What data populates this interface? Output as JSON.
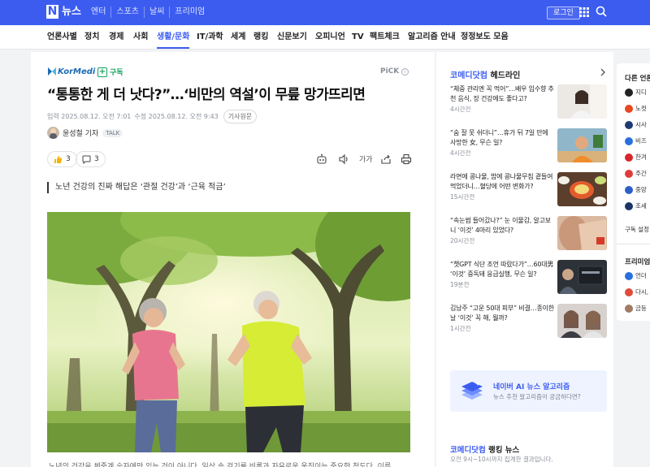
{
  "topbar": {
    "logo_mark": "N",
    "logo_text": "뉴스",
    "links": [
      "엔터",
      "스포츠",
      "날씨",
      "프리미엄"
    ],
    "login_label": "로그인"
  },
  "nav": {
    "items": [
      "언론사별",
      "정치",
      "경제",
      "사회",
      "생활/문화",
      "IT/과학",
      "세계",
      "랭킹",
      "신문보기",
      "오피니언",
      "TV",
      "팩트체크",
      "알고리즘 안내",
      "정정보도 모음"
    ],
    "active_index": 4
  },
  "article": {
    "press_name": "KorMedi",
    "subscribe_label": "구독",
    "pick_label": "PiCK",
    "headline": "“통통한 게 더 낫다?”…‘비만의 역설’이 무릎 망가뜨리면",
    "published": "입력 2025.08.12. 오전 7:01",
    "modified": "수정 2025.08.12. 오전 9:43",
    "original_label": "기사원문",
    "reporter": "윤성철 기자",
    "talk_label": "TALK",
    "reaction_count": "3",
    "comment_count": "3",
    "font_size_label": "가가",
    "subhead": "노년 건강의 진짜 해답은 ‘관절 건강’과 ‘근육 적금’",
    "body_preview": "노년의 건강을 체중계 숫자에만 있는 것이 아니다. 일상 속 걷기를 비롯과 자유로운 움직이는 중요한 척도다. 이름"
  },
  "right": {
    "headline_brand": "코메디닷컴",
    "headline_suffix": " 헤드라인",
    "news": [
      {
        "title": "“체중 관리엔 꼭 먹어”…배우 임수향 추천 음식, 장 건강에도 좋다고?",
        "time": "4시간전"
      },
      {
        "title": "“숨 잘 못 쉬더니”…휴가 뒤 7일 만에 사망한 女, 무슨 일?",
        "time": "4시간전"
      },
      {
        "title": "라면에 콩나물, 밥에 콩나물무침 곁들여 먹었더니…혈당에 어떤 변화가?",
        "time": "15시간전"
      },
      {
        "title": "“속눈썹 들어갔나?” 눈 이물감, 알고보니 ‘이것’ 4마리 있었다?",
        "time": "20시간전"
      },
      {
        "title": "“챗GPT 식단 조언 따랐다가”…60대男 ‘이것’ 중독돼 응급실행, 무슨 일?",
        "time": "19분전"
      },
      {
        "title": "김남주 “고운 50대 피부” 비결…종이한 날 ‘이것’ 꼭 해, 뭘까?",
        "time": "1시간전"
      }
    ],
    "ai_title": "네이버 AI 뉴스 알고리즘",
    "ai_sub": "뉴스 추천 알고리즘이 궁금하다면?",
    "ranking_brand": "코메디닷컴",
    "ranking_suffix": " 랭킹 뉴스",
    "ranking_sub": "오전 9시~10시까지 집계한 결과입니다."
  },
  "farright": {
    "head": "다른 언론사",
    "rows": [
      "지디",
      "노컷",
      "시사",
      "비즈",
      "한겨",
      "주간",
      "중앙",
      "조세"
    ],
    "subscribe_setting": "구독 설정",
    "premium_head": "프리미엄",
    "premium_rows": [
      "언더",
      "다시,",
      "금등"
    ]
  },
  "colors": {
    "accent": "#3c5cf0",
    "subscribe": "#13a35c",
    "press": "#1b6bb5"
  }
}
